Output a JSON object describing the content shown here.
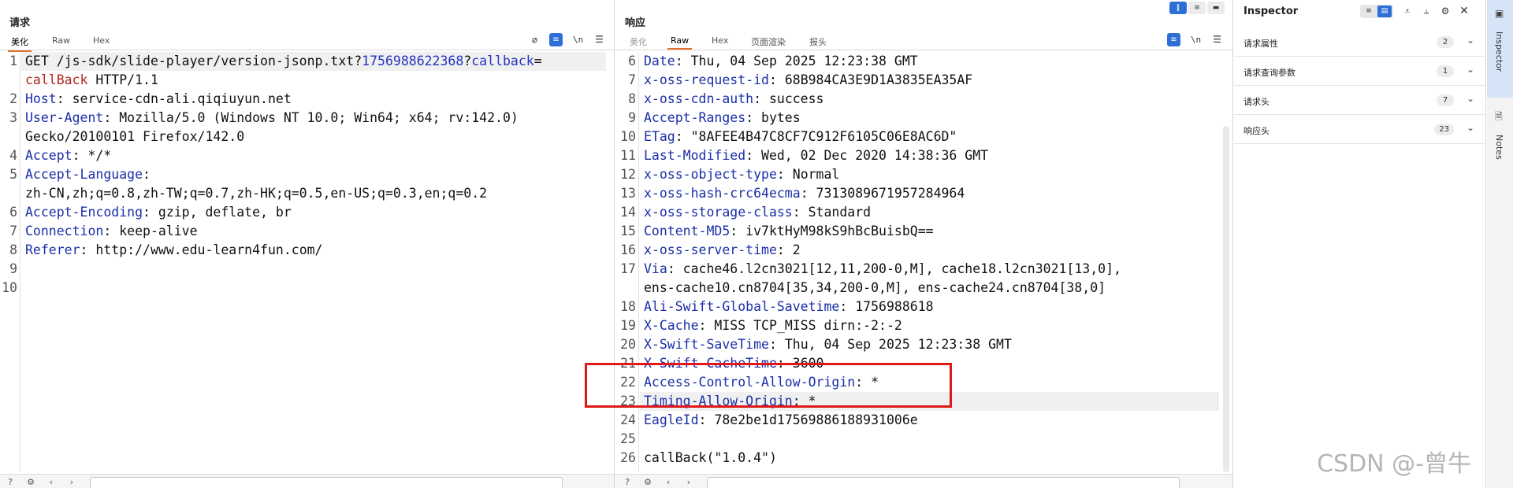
{
  "request": {
    "title": "请求",
    "tabs": [
      {
        "label": "美化",
        "active": true
      },
      {
        "label": "Raw",
        "active": false
      },
      {
        "label": "Hex",
        "active": false
      }
    ],
    "toolbar_icons": [
      "eye-slash-icon",
      "wrap-icon",
      "newline-icon",
      "menu-icon"
    ],
    "newline_label": "\\n",
    "line_numbers": [
      "1",
      "2",
      "3",
      "4",
      "5",
      "6",
      "7",
      "8",
      "9",
      "10"
    ],
    "lines": [
      [
        {
          "t": "GET /js-sdk/slide-player/version-jsonp.txt?",
          "c": ""
        },
        {
          "t": "1756988622368",
          "c": "hq"
        },
        {
          "t": "?",
          "c": ""
        },
        {
          "t": "callback",
          "c": "hq"
        },
        {
          "t": "=",
          "c": ""
        }
      ],
      [
        {
          "t": "callBack",
          "c": "kw"
        },
        {
          "t": " HTTP/1.1",
          "c": ""
        }
      ],
      [
        {
          "t": "Host",
          "c": "hk"
        },
        {
          "t": ": service-cdn-ali.qiqiuyun.net",
          "c": ""
        }
      ],
      [
        {
          "t": "User-Agent",
          "c": "hk"
        },
        {
          "t": ": Mozilla/5.0 (Windows NT 10.0; Win64; x64; rv:142.0)",
          "c": ""
        }
      ],
      [
        {
          "t": "Gecko/20100101 Firefox/142.0",
          "c": ""
        }
      ],
      [
        {
          "t": "Accept",
          "c": "hk"
        },
        {
          "t": ": */*",
          "c": ""
        }
      ],
      [
        {
          "t": "Accept-Language",
          "c": "hk"
        },
        {
          "t": ":",
          "c": ""
        }
      ],
      [
        {
          "t": "zh-CN,zh;q=0.8,zh-TW;q=0.7,zh-HK;q=0.5,en-US;q=0.3,en;q=0.2",
          "c": ""
        }
      ],
      [
        {
          "t": "Accept-Encoding",
          "c": "hk"
        },
        {
          "t": ": gzip, deflate, br",
          "c": ""
        }
      ],
      [
        {
          "t": "Connection",
          "c": "hk"
        },
        {
          "t": ": keep-alive",
          "c": ""
        }
      ],
      [
        {
          "t": "Referer",
          "c": "hk"
        },
        {
          "t": ": http://www.edu-learn4fun.com/",
          "c": ""
        }
      ]
    ]
  },
  "response": {
    "title": "响应",
    "tabs": [
      {
        "label": "美化",
        "active": false,
        "disabled": true
      },
      {
        "label": "Raw",
        "active": true
      },
      {
        "label": "Hex",
        "active": false
      },
      {
        "label": "页面渲染",
        "active": false
      },
      {
        "label": "报头",
        "active": false
      }
    ],
    "newline_label": "\\n",
    "line_numbers": [
      "6",
      "7",
      "8",
      "9",
      "10",
      "11",
      "12",
      "13",
      "14",
      "15",
      "16",
      "17",
      "18",
      "19",
      "20",
      "21",
      "22",
      "23",
      "24",
      "25",
      "26"
    ],
    "lines": [
      [
        {
          "t": "Date",
          "c": "hk"
        },
        {
          "t": ": Thu, 04 Sep 2025 12:23:38 GMT",
          "c": ""
        }
      ],
      [
        {
          "t": "x-oss-request-id",
          "c": "hk"
        },
        {
          "t": ": 68B984CA3E9D1A3835EA35AF",
          "c": ""
        }
      ],
      [
        {
          "t": "x-oss-cdn-auth",
          "c": "hk"
        },
        {
          "t": ": success",
          "c": ""
        }
      ],
      [
        {
          "t": "Accept-Ranges",
          "c": "hk"
        },
        {
          "t": ": bytes",
          "c": ""
        }
      ],
      [
        {
          "t": "ETag",
          "c": "hk"
        },
        {
          "t": ": \"8AFEE4B47C8CF7C912F6105C06E8AC6D\"",
          "c": ""
        }
      ],
      [
        {
          "t": "Last-Modified",
          "c": "hk"
        },
        {
          "t": ": Wed, 02 Dec 2020 14:38:36 GMT",
          "c": ""
        }
      ],
      [
        {
          "t": "x-oss-object-type",
          "c": "hk"
        },
        {
          "t": ": Normal",
          "c": ""
        }
      ],
      [
        {
          "t": "x-oss-hash-crc64ecma",
          "c": "hk"
        },
        {
          "t": ": 7313089671957284964",
          "c": ""
        }
      ],
      [
        {
          "t": "x-oss-storage-class",
          "c": "hk"
        },
        {
          "t": ": Standard",
          "c": ""
        }
      ],
      [
        {
          "t": "Content-MD5",
          "c": "hk"
        },
        {
          "t": ": iv7ktHyM98kS9hBcBuisbQ==",
          "c": ""
        }
      ],
      [
        {
          "t": "x-oss-server-time",
          "c": "hk"
        },
        {
          "t": ": 2",
          "c": ""
        }
      ],
      [
        {
          "t": "Via",
          "c": "hk"
        },
        {
          "t": ": cache46.l2cn3021[12,11,200-0,M], cache18.l2cn3021[13,0],",
          "c": ""
        }
      ],
      [
        {
          "t": "ens-cache10.cn8704[35,34,200-0,M], ens-cache24.cn8704[38,0]",
          "c": ""
        }
      ],
      [
        {
          "t": "Ali-Swift-Global-Savetime",
          "c": "hk"
        },
        {
          "t": ": 1756988618",
          "c": ""
        }
      ],
      [
        {
          "t": "X-Cache",
          "c": "hk"
        },
        {
          "t": ": MISS TCP_MISS dirn:-2:-2",
          "c": ""
        }
      ],
      [
        {
          "t": "X-Swift-SaveTime",
          "c": "hk"
        },
        {
          "t": ": Thu, 04 Sep 2025 12:23:38 GMT",
          "c": ""
        }
      ],
      [
        {
          "t": "X-Swift-CacheTime",
          "c": "hk"
        },
        {
          "t": ": 3600",
          "c": ""
        }
      ],
      [
        {
          "t": "Access-Control-Allow-Origin",
          "c": "hk"
        },
        {
          "t": ": *",
          "c": ""
        }
      ],
      [
        {
          "t": "Timing-Allow-Origin",
          "c": "hk"
        },
        {
          "t": ": *",
          "c": ""
        }
      ],
      [
        {
          "t": "EagleId",
          "c": "hk"
        },
        {
          "t": ": 78e2be1d17569886188931006e",
          "c": ""
        }
      ],
      [
        {
          "t": "",
          "c": ""
        }
      ],
      [
        {
          "t": "callBack(\"1.0.4\")",
          "c": ""
        }
      ]
    ]
  },
  "inspector": {
    "title": "Inspector",
    "rows": [
      {
        "label": "请求属性",
        "count": "2"
      },
      {
        "label": "请求查询参数",
        "count": "1"
      },
      {
        "label": "请求头",
        "count": "7"
      },
      {
        "label": "响应头",
        "count": "23"
      }
    ]
  },
  "side_rail": {
    "inspector_label": "Inspector",
    "notes_label": "Notes"
  },
  "watermark": "CSDN @-曾牛",
  "colors": {
    "accent": "#e8702a",
    "header_key": "#1a2fa8",
    "keyword": "#b3261e",
    "highlight_box": "#e01818",
    "toggle_blue": "#2d6fd6"
  }
}
